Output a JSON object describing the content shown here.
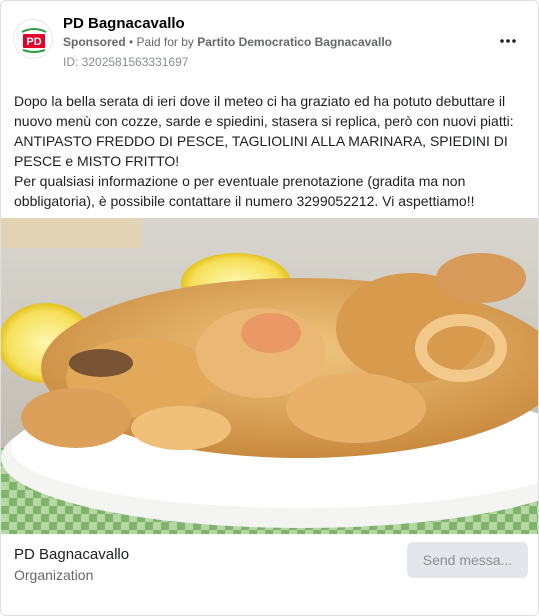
{
  "header": {
    "page_name": "PD Bagnacavallo",
    "sponsored": "Sponsored",
    "separator": " • ",
    "paid_for_prefix": "Paid for by ",
    "payer": "Partito Democratico Bagnacavallo",
    "ad_id": "ID: 3202581563331697",
    "more_icon": "more-horizontal-icon"
  },
  "body": {
    "line1": "Dopo la bella serata di ieri dove il meteo ci ha graziato ed ha potuto debuttare il nuovo menù con cozze, sarde e spiedini, stasera si replica, però con nuovi piatti: ANTIPASTO FREDDO DI PESCE, TAGLIOLINI ALLA MARINARA, SPIEDINI DI PESCE e MISTO FRITTO!",
    "line2": "Per qualsiasi informazione o per eventuale prenotazione (gradita ma non obbligatoria), è possibile contattare il numero 3299052212. Vi aspettiamo!!"
  },
  "footer": {
    "name": "PD Bagnacavallo",
    "category": "Organization",
    "send_label": "Send messa..."
  },
  "colors": {
    "accent_red": "#e4002b",
    "accent_green": "#2e9a3e",
    "muted": "#65676b"
  }
}
